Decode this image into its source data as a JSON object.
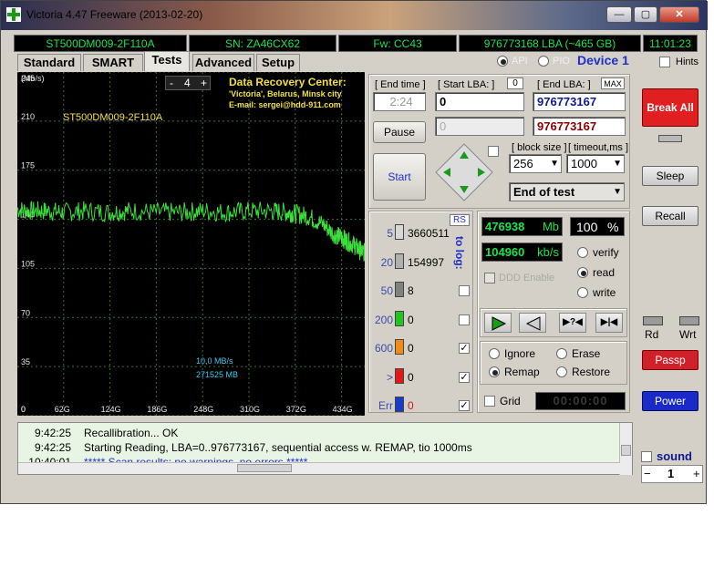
{
  "window": {
    "title": "Victoria 4.47  Freeware (2013-02-20)"
  },
  "winbuttons": {
    "minimize": "—",
    "maximize": "▢",
    "close": "✕"
  },
  "infobar": {
    "model": "ST500DM009-2F110A",
    "serial": "SN: ZA46CX62",
    "firmware": "Fw: CC43",
    "lba": "976773168 LBA (~465 GB)",
    "clock": "11:01:23"
  },
  "tabs": [
    "Standard",
    "SMART",
    "Tests",
    "Advanced",
    "Setup"
  ],
  "active_tab": "Tests",
  "mode": {
    "api": "API",
    "pio": "PIO",
    "device": "Device 1",
    "hints": "Hints"
  },
  "graph": {
    "unit": "(Mb/s)",
    "counter": "4",
    "minus": "-",
    "plus": "+",
    "y_ticks": [
      "245",
      "210",
      "175",
      "140",
      "105",
      "70",
      "35",
      "0"
    ],
    "x_ticks": [
      "62G",
      "124G",
      "186G",
      "248G",
      "310G",
      "372G",
      "434G"
    ],
    "drive_label": "ST500DM009-2F110A",
    "recovery": {
      "title": "Data Recovery Center:",
      "line1": "'Victoria', Belarus, Minsk city",
      "line2": "E-mail: sergei@hdd-911.com"
    },
    "speed": "10,0 MB/s",
    "size": "271525 MB"
  },
  "chart_data": {
    "type": "line",
    "title": "",
    "xlabel": "",
    "ylabel": "(Mb/s)",
    "xlim": [
      0,
      465
    ],
    "ylim": [
      0,
      245
    ],
    "grid": true,
    "series": [
      {
        "x": [
          0,
          20,
          40,
          62,
          90,
          124,
          150,
          186,
          220,
          248,
          280,
          310,
          340,
          360,
          372,
          390,
          410,
          425,
          434,
          440,
          450,
          458,
          465
        ],
        "y": [
          147,
          146,
          146,
          145,
          146,
          145,
          146,
          145,
          145,
          146,
          145,
          146,
          146,
          145,
          144,
          142,
          136,
          129,
          127,
          125,
          122,
          118,
          116
        ]
      }
    ]
  },
  "controls": {
    "end_time_label": "[ End time ]",
    "end_time_value": "2:24",
    "start_lba_label": "[ Start LBA: ]",
    "start_lba_badge": "0",
    "start_lba_value": "0",
    "end_lba_label": "[ End LBA: ]",
    "end_lba_max": "MAX",
    "end_lba_value": "976773167",
    "cur_lba_value": "0",
    "cur_end_value": "976773167",
    "pause": "Pause",
    "start": "Start",
    "block_size_label": "[ block size ]",
    "block_size_value": "256",
    "timeout_label": "[ timeout,ms ]",
    "timeout_value": "1000",
    "end_action": "End of test"
  },
  "counters": {
    "rs": "RS",
    "to_log": "to log:",
    "rows": [
      {
        "label": "5",
        "value": "3660511",
        "color": "#d8d8d8"
      },
      {
        "label": "20",
        "value": "154997",
        "color": "#b0b0b0"
      },
      {
        "label": "50",
        "value": "8",
        "color": "#808080"
      },
      {
        "label": "200",
        "value": "0",
        "color": "#22c322"
      },
      {
        "label": "600",
        "value": "0",
        "color": "#f08a18"
      },
      {
        "label": ">",
        "value": "0",
        "color": "#e01818"
      },
      {
        "label": "Err",
        "value": "0",
        "color": "#1a3ac8"
      }
    ]
  },
  "progress": {
    "mb": "476938",
    "mb_unit": "Mb",
    "percent": "100",
    "percent_unit": "%",
    "speed": "104960",
    "speed_unit": "kb/s",
    "ddd": "DDD Enable"
  },
  "mode_radios": {
    "verify": "verify",
    "read": "read",
    "write": "write"
  },
  "actions": {
    "ignore": "Ignore",
    "erase": "Erase",
    "remap": "Remap",
    "restore": "Restore",
    "grid": "Grid",
    "timer": "00:00:00"
  },
  "side": {
    "break_all": "Break All",
    "sleep": "Sleep",
    "recall": "Recall",
    "rd": "Rd",
    "wrt": "Wrt",
    "passp": "Passp",
    "power": "Power",
    "sound": "sound",
    "sound_value": "1",
    "dec": "−",
    "inc": "+"
  },
  "log": [
    {
      "time": "9:42:25",
      "text": "Recallibration... OK"
    },
    {
      "time": "9:42:25",
      "text": "Starting Reading, LBA=0..976773167, sequential access w. REMAP, tio 1000ms"
    },
    {
      "time": "10:40:01",
      "text": "***** Scan results: no warnings, no errors *****"
    }
  ],
  "colors": {
    "accent_green": "#19e34f",
    "break_red": "#e02020",
    "power_blue": "#1a2ac8"
  }
}
